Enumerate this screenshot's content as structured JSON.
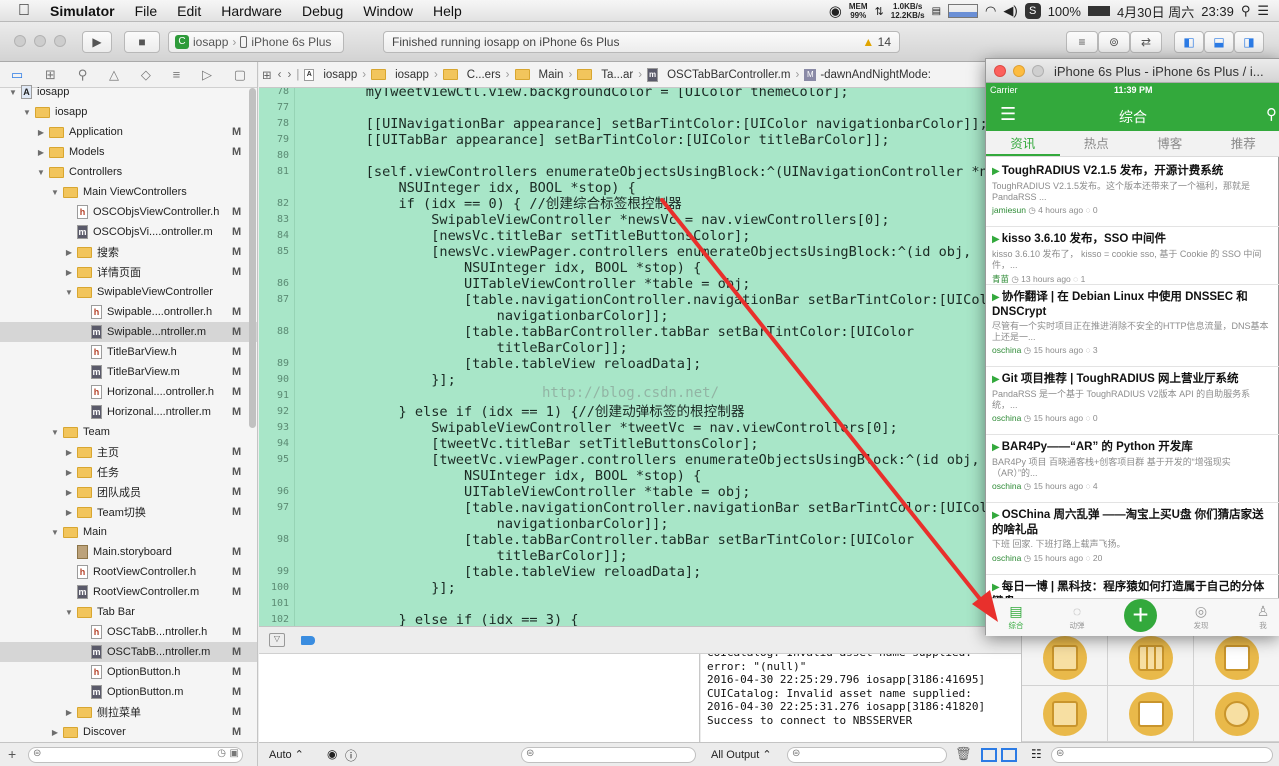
{
  "menubar": {
    "apple": "",
    "app": "Simulator",
    "items": [
      "File",
      "Edit",
      "Hardware",
      "Debug",
      "Window",
      "Help"
    ],
    "mem_label": "MEM",
    "mem_value": "99%",
    "net_up": "1.0KB/s",
    "net_down": "12.2KB/s",
    "battery": "100%",
    "date": "4月30日 周六",
    "time": "23:39"
  },
  "toolbar": {
    "scheme_app": "iosapp",
    "scheme_device": "iPhone 6s Plus",
    "status_text": "Finished running iosapp on iPhone 6s Plus",
    "warning_count": "14"
  },
  "navigator": {
    "rows": [
      {
        "label": "iosapp",
        "indent": 0,
        "type": "proj",
        "open": true,
        "flag": ""
      },
      {
        "label": "iosapp",
        "indent": 1,
        "type": "folder",
        "open": true,
        "flag": ""
      },
      {
        "label": "Application",
        "indent": 2,
        "type": "folder",
        "open": false,
        "flag": "M"
      },
      {
        "label": "Models",
        "indent": 2,
        "type": "folder",
        "open": false,
        "flag": "M"
      },
      {
        "label": "Controllers",
        "indent": 2,
        "type": "folder",
        "open": true,
        "flag": ""
      },
      {
        "label": "Main ViewControllers",
        "indent": 3,
        "type": "folder",
        "open": true,
        "flag": ""
      },
      {
        "label": "OSCObjsViewController.h",
        "indent": 4,
        "type": "h",
        "flag": "M"
      },
      {
        "label": "OSCObjsVi....ontroller.m",
        "indent": 4,
        "type": "m",
        "flag": "M"
      },
      {
        "label": "搜索",
        "indent": 4,
        "type": "folder",
        "open": false,
        "flag": "M"
      },
      {
        "label": "详情页面",
        "indent": 4,
        "type": "folder",
        "open": false,
        "flag": "M"
      },
      {
        "label": "SwipableViewController",
        "indent": 4,
        "type": "folder",
        "open": true,
        "flag": ""
      },
      {
        "label": "Swipable....ontroller.h",
        "indent": 5,
        "type": "h",
        "flag": "M"
      },
      {
        "label": "Swipable...ntroller.m",
        "indent": 5,
        "type": "m",
        "flag": "M",
        "selected": true
      },
      {
        "label": "TitleBarView.h",
        "indent": 5,
        "type": "h",
        "flag": "M"
      },
      {
        "label": "TitleBarView.m",
        "indent": 5,
        "type": "m",
        "flag": "M"
      },
      {
        "label": "Horizonal....ontroller.h",
        "indent": 5,
        "type": "h",
        "flag": "M"
      },
      {
        "label": "Horizonal....ntroller.m",
        "indent": 5,
        "type": "m",
        "flag": "M"
      },
      {
        "label": "Team",
        "indent": 3,
        "type": "folder",
        "open": true,
        "flag": ""
      },
      {
        "label": "主页",
        "indent": 4,
        "type": "folder",
        "open": false,
        "flag": "M"
      },
      {
        "label": "任务",
        "indent": 4,
        "type": "folder",
        "open": false,
        "flag": "M"
      },
      {
        "label": "团队成员",
        "indent": 4,
        "type": "folder",
        "open": false,
        "flag": "M"
      },
      {
        "label": "Team切换",
        "indent": 4,
        "type": "folder",
        "open": false,
        "flag": "M"
      },
      {
        "label": "Main",
        "indent": 3,
        "type": "folder",
        "open": true,
        "flag": ""
      },
      {
        "label": "Main.storyboard",
        "indent": 4,
        "type": "sb",
        "flag": "M"
      },
      {
        "label": "RootViewController.h",
        "indent": 4,
        "type": "h",
        "flag": "M"
      },
      {
        "label": "RootViewController.m",
        "indent": 4,
        "type": "m",
        "flag": "M"
      },
      {
        "label": "Tab Bar",
        "indent": 4,
        "type": "folder",
        "open": true,
        "flag": ""
      },
      {
        "label": "OSCTabB...ntroller.h",
        "indent": 5,
        "type": "h",
        "flag": "M"
      },
      {
        "label": "OSCTabB...ntroller.m",
        "indent": 5,
        "type": "m",
        "flag": "M",
        "selected": true
      },
      {
        "label": "OptionButton.h",
        "indent": 5,
        "type": "h",
        "flag": "M"
      },
      {
        "label": "OptionButton.m",
        "indent": 5,
        "type": "m",
        "flag": "M"
      },
      {
        "label": "侧拉菜单",
        "indent": 4,
        "type": "folder",
        "open": false,
        "flag": "M"
      },
      {
        "label": "Discover",
        "indent": 3,
        "type": "folder",
        "open": false,
        "flag": "M"
      }
    ]
  },
  "jumpbar": {
    "crumbs": [
      "iosapp",
      "iosapp",
      "C...ers",
      "Main",
      "Ta...ar",
      "OSCTabBarController.m",
      "-dawnAndNightMode:"
    ]
  },
  "code": {
    "lines": [
      {
        "n": "78",
        "t": "    myTweetViewCtl.view.backgroundColor = [UIColor themeColor];"
      },
      {
        "n": "77",
        "t": ""
      },
      {
        "n": "78",
        "t": "    [[UINavigationBar appearance] setBarTintColor:[UIColor navigationbarColor]];"
      },
      {
        "n": "79",
        "t": "    [[UITabBar appearance] setBarTintColor:[UIColor titleBarColor]];"
      },
      {
        "n": "80",
        "t": ""
      },
      {
        "n": "81",
        "t": "    [self.viewControllers enumerateObjectsUsingBlock:^(UINavigationController *nav,"
      },
      {
        "n": "",
        "t": "        NSUInteger idx, BOOL *stop) {"
      },
      {
        "n": "82",
        "t": "        if (idx == 0) { //创建综合标签根控制器"
      },
      {
        "n": "83",
        "t": "            SwipableViewController *newsVc = nav.viewControllers[0];"
      },
      {
        "n": "84",
        "t": "            [newsVc.titleBar setTitleButtonsColor];"
      },
      {
        "n": "85",
        "t": "            [newsVc.viewPager.controllers enumerateObjectsUsingBlock:^(id obj,"
      },
      {
        "n": "",
        "t": "                NSUInteger idx, BOOL *stop) {"
      },
      {
        "n": "86",
        "t": "                UITableViewController *table = obj;"
      },
      {
        "n": "87",
        "t": "                [table.navigationController.navigationBar setBarTintColor:[UIColor"
      },
      {
        "n": "",
        "t": "                    navigationbarColor]];"
      },
      {
        "n": "88",
        "t": "                [table.tabBarController.tabBar setBarTintColor:[UIColor"
      },
      {
        "n": "",
        "t": "                    titleBarColor]];"
      },
      {
        "n": "89",
        "t": "                [table.tableView reloadData];"
      },
      {
        "n": "90",
        "t": "            }];"
      },
      {
        "n": "91",
        "t": ""
      },
      {
        "n": "92",
        "t": "        } else if (idx == 1) {//创建动弹标签的根控制器"
      },
      {
        "n": "93",
        "t": "            SwipableViewController *tweetVc = nav.viewControllers[0];"
      },
      {
        "n": "94",
        "t": "            [tweetVc.titleBar setTitleButtonsColor];"
      },
      {
        "n": "95",
        "t": "            [tweetVc.viewPager.controllers enumerateObjectsUsingBlock:^(id obj,"
      },
      {
        "n": "",
        "t": "                NSUInteger idx, BOOL *stop) {"
      },
      {
        "n": "96",
        "t": "                UITableViewController *table = obj;"
      },
      {
        "n": "97",
        "t": "                [table.navigationController.navigationBar setBarTintColor:[UIColor"
      },
      {
        "n": "",
        "t": "                    navigationbarColor]];"
      },
      {
        "n": "98",
        "t": "                [table.tabBarController.tabBar setBarTintColor:[UIColor"
      },
      {
        "n": "",
        "t": "                    titleBarColor]];"
      },
      {
        "n": "99",
        "t": "                [table.tableView reloadData];"
      },
      {
        "n": "100",
        "t": "            }];"
      },
      {
        "n": "101",
        "t": ""
      },
      {
        "n": "102",
        "t": "        } else if (idx == 3) {"
      }
    ],
    "watermark": "http://blog.csdn.net/"
  },
  "console": {
    "lines": [
      "CUICatalog: Invalid asset name supplied:",
      "error: \"(null)\"",
      "2016-04-30 22:25:29.796 iosapp[3186:41695]",
      "CUICatalog: Invalid asset name supplied:",
      "2016-04-30 22:25:31.276 iosapp[3186:41820]",
      "Success to connect to NBSSERVER"
    ],
    "filter": "All Output ⌃"
  },
  "bottom": {
    "auto": "Auto ⌃"
  },
  "simulator": {
    "title": "iPhone 6s Plus - iPhone 6s Plus / i...",
    "carrier": "Carrier",
    "time": "11:39 PM",
    "nav_title": "综合",
    "tabs": [
      "资讯",
      "热点",
      "博客",
      "推荐"
    ],
    "news": [
      {
        "title": "ToughRADIUS V2.1.5 发布，开源计费系统",
        "desc": "ToughRADIUS V2.1.5发布。这个版本还带来了一个福利，那就是 PandaRSS ...",
        "author": "jamiesun",
        "time": "4 hours ago",
        "comments": "0"
      },
      {
        "title": "kisso 3.6.10 发布，SSO 中间件",
        "desc": "kisso 3.6.10 发布了， kisso = cookie sso, 基于 Cookie 的 SSO 中间件，...",
        "author": "青苗",
        "time": "13 hours ago",
        "comments": "1"
      },
      {
        "title": "协作翻译 | 在 Debian Linux 中使用 DNSSEC 和 DNSCrypt",
        "desc": "尽管有一个实时项目正在推进消除不安全的HTTP信息流量，DNS基本上还是一...",
        "author": "oschina",
        "time": "15 hours ago",
        "comments": "3"
      },
      {
        "title": "Git 项目推荐 | ToughRADIUS 网上营业厅系统",
        "desc": "PandaRSS 是一个基于 ToughRADIUS V2版本 API 的自助服务系统，...",
        "author": "oschina",
        "time": "15 hours ago",
        "comments": "0"
      },
      {
        "title": "BAR4Py——“AR” 的 Python 开发库",
        "desc": "BAR4Py 项目 百晓通客栈+创客项目群 基于开发的“增强现实（AR）”的...",
        "author": "oschina",
        "time": "15 hours ago",
        "comments": "4"
      },
      {
        "title": "OSChina 周六乱弹 ——淘宝上买U盘 你们猜店家送的啥礼品",
        "desc": "下班 回家. 下班打路上载声飞扬。",
        "author": "oschina",
        "time": "15 hours ago",
        "comments": "20"
      },
      {
        "title": "每日一博 | 黑科技：程序猿如何打造属于自己的分体键盘",
        "desc": "",
        "author": "",
        "time": "",
        "comments": ""
      }
    ],
    "tabbar": [
      "综合",
      "动弹",
      "",
      "发现",
      "我"
    ]
  },
  "colors": {
    "editor_bg": "#a8e6c8",
    "ios_green": "#33a93c",
    "arrow": "#e8302c"
  }
}
